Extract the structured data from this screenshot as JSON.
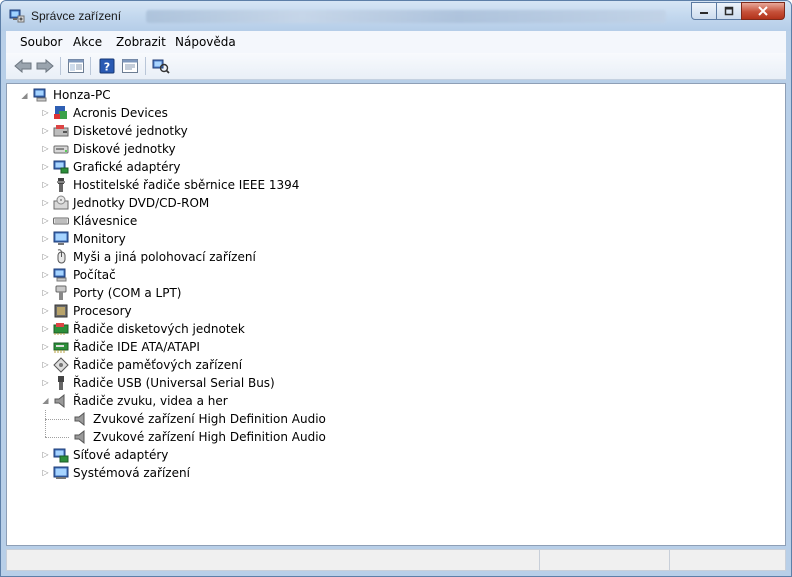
{
  "window": {
    "title": "Správce zařízení"
  },
  "menu": [
    "Soubor",
    "Akce",
    "Zobrazit",
    "Nápověda"
  ],
  "tree": {
    "root": "Honza-PC",
    "categories": [
      {
        "label": "Acronis Devices",
        "icon": "acronis-icon",
        "expanded": false
      },
      {
        "label": "Disketové jednotky",
        "icon": "floppy-icon",
        "expanded": false
      },
      {
        "label": "Diskové jednotky",
        "icon": "hdd-icon",
        "expanded": false
      },
      {
        "label": "Grafické adaptéry",
        "icon": "display-adapter-icon",
        "expanded": false
      },
      {
        "label": "Hostitelské řadiče sběrnice IEEE 1394",
        "icon": "firewire-icon",
        "expanded": false
      },
      {
        "label": "Jednotky DVD/CD-ROM",
        "icon": "dvd-icon",
        "expanded": false
      },
      {
        "label": "Klávesnice",
        "icon": "keyboard-icon",
        "expanded": false
      },
      {
        "label": "Monitory",
        "icon": "monitor-icon",
        "expanded": false
      },
      {
        "label": "Myši a jiná polohovací zařízení",
        "icon": "mouse-icon",
        "expanded": false
      },
      {
        "label": "Počítač",
        "icon": "computer-icon",
        "expanded": false
      },
      {
        "label": "Porty (COM a LPT)",
        "icon": "port-icon",
        "expanded": false
      },
      {
        "label": "Procesory",
        "icon": "cpu-icon",
        "expanded": false
      },
      {
        "label": "Řadiče disketových jednotek",
        "icon": "floppy-controller-icon",
        "expanded": false
      },
      {
        "label": "Řadiče IDE ATA/ATAPI",
        "icon": "ide-controller-icon",
        "expanded": false
      },
      {
        "label": "Řadiče paměťových zařízení",
        "icon": "storage-controller-icon",
        "expanded": false
      },
      {
        "label": "Řadiče USB (Universal Serial Bus)",
        "icon": "usb-icon",
        "expanded": false
      },
      {
        "label": "Řadiče zvuku, videa a her",
        "icon": "speaker-icon",
        "expanded": true,
        "children": [
          "Zvukové zařízení High Definition Audio",
          "Zvukové zařízení High Definition Audio"
        ]
      },
      {
        "label": "Síťové adaptéry",
        "icon": "network-adapter-icon",
        "expanded": false
      },
      {
        "label": "Systémová zařízení",
        "icon": "system-device-icon",
        "expanded": false
      }
    ]
  }
}
